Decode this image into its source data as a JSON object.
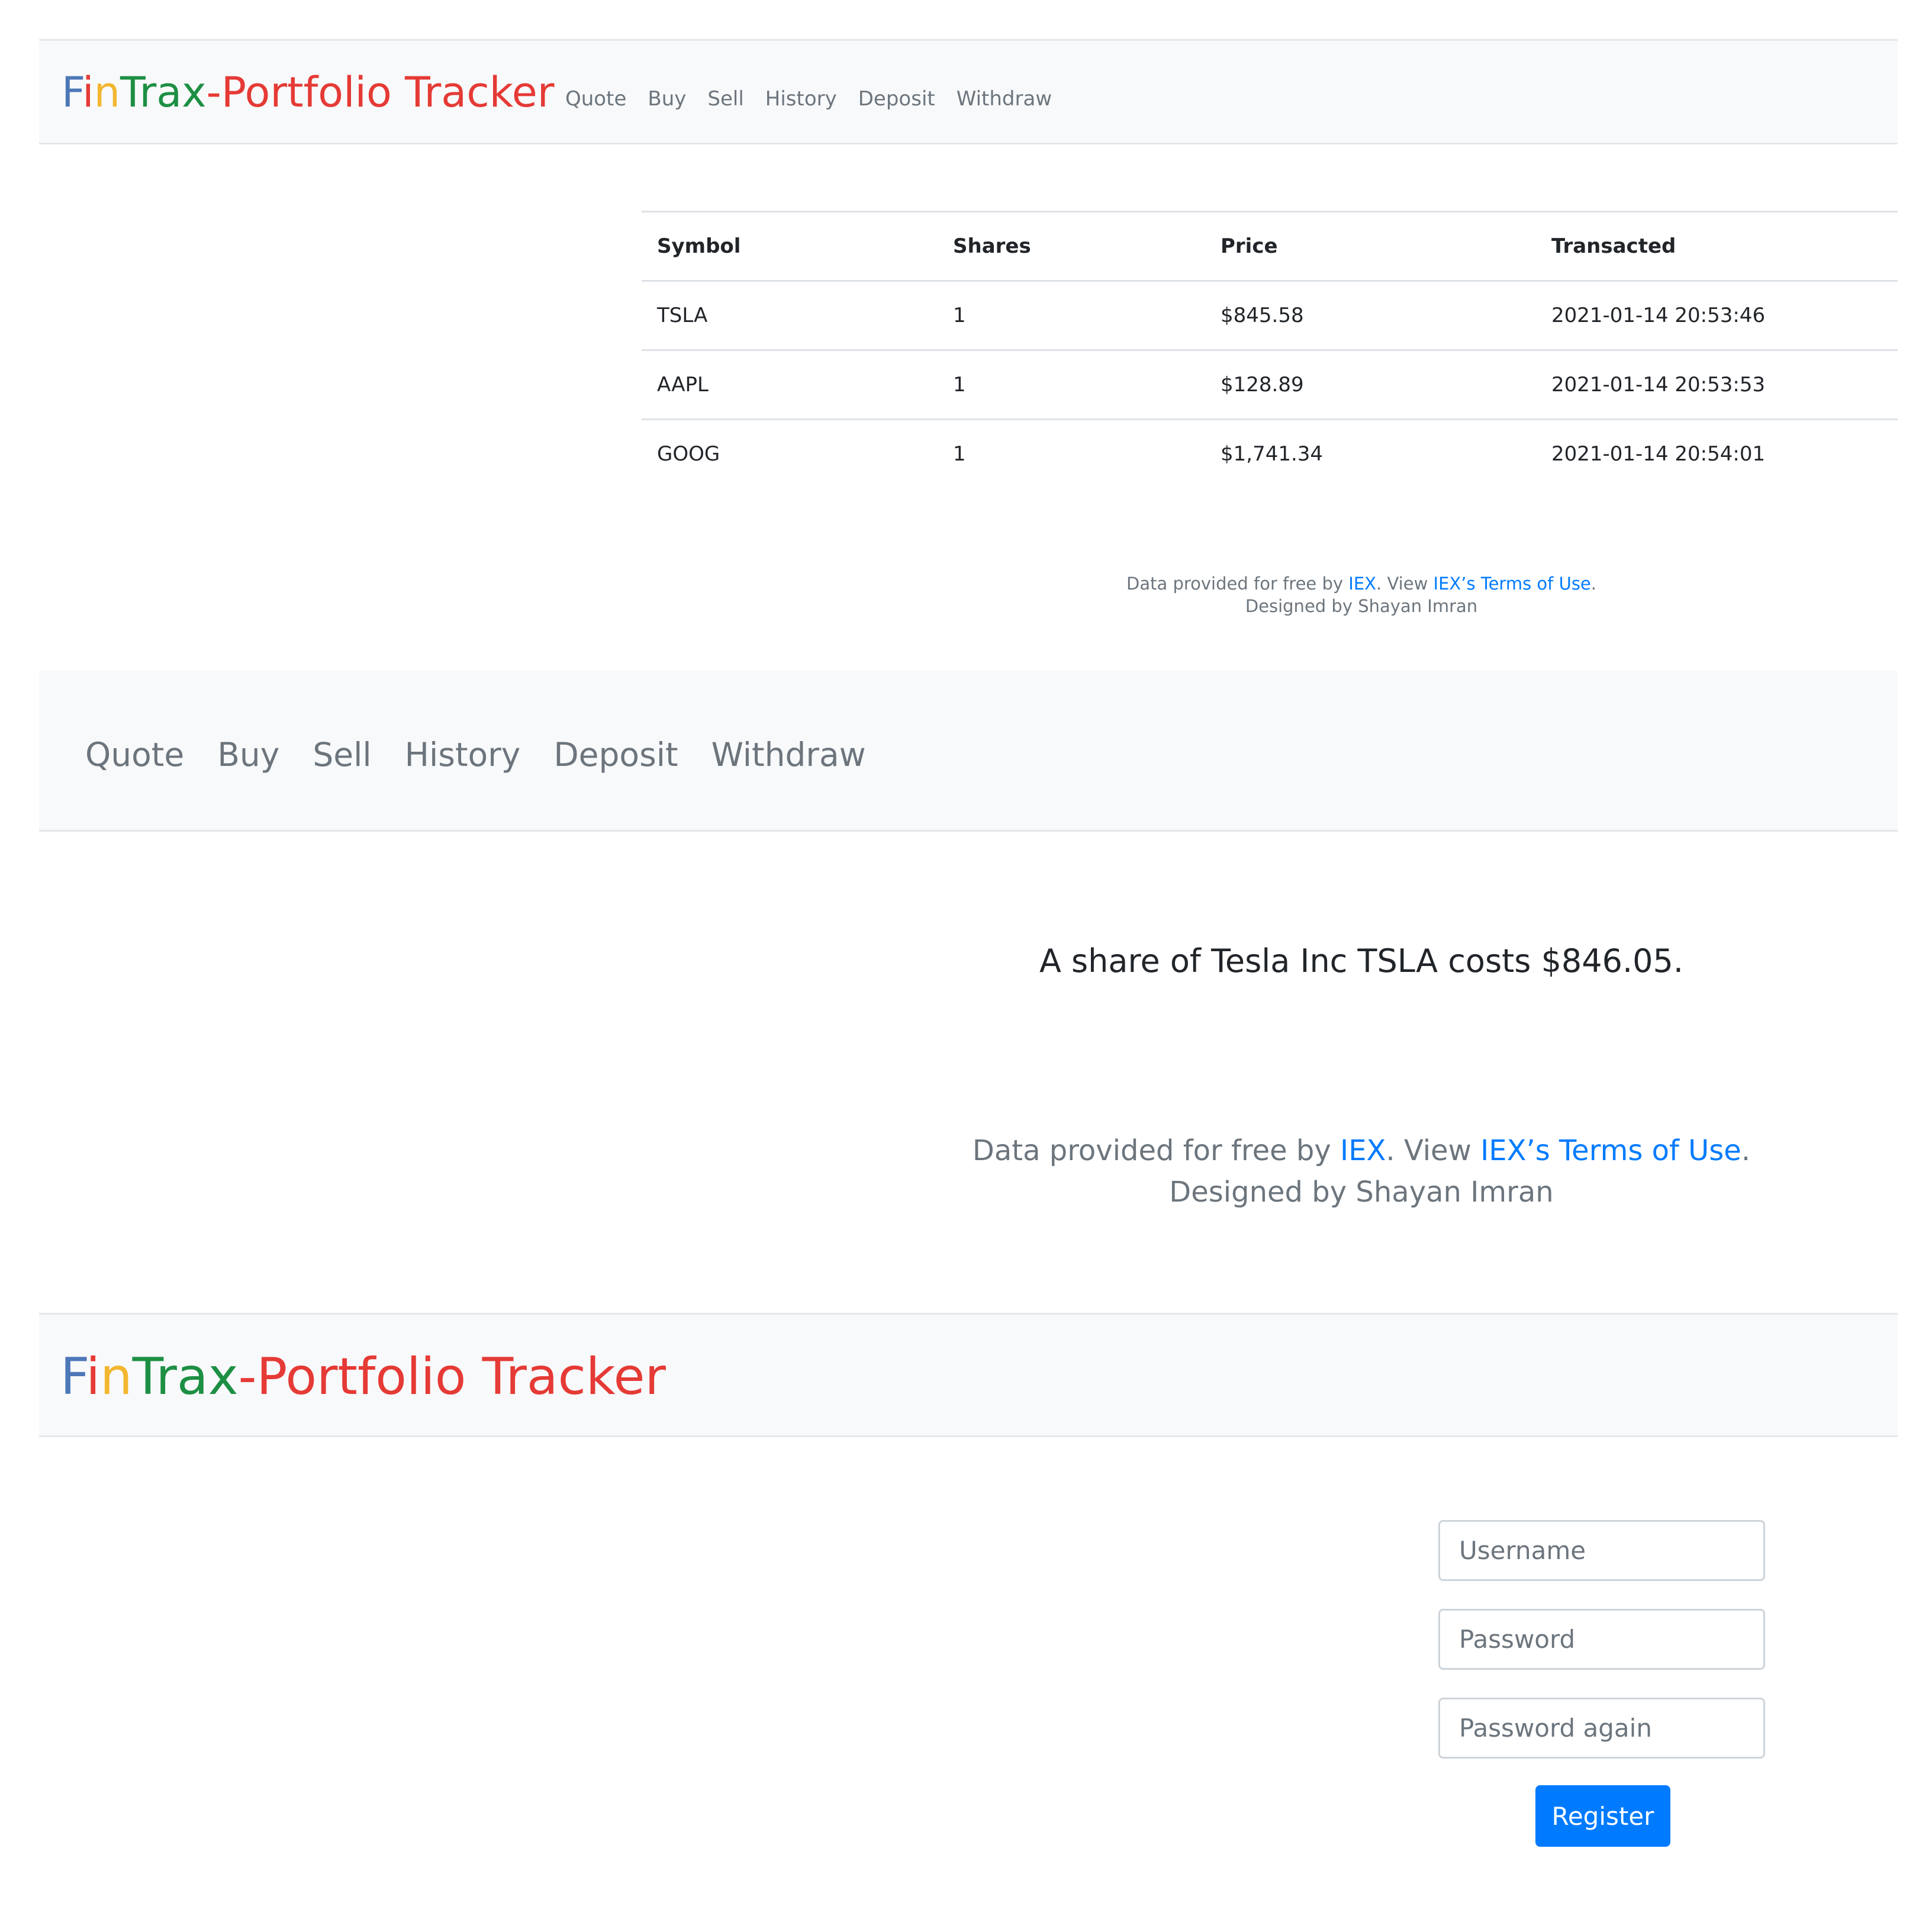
{
  "brand": {
    "f": "F",
    "i": "i",
    "n": "n",
    "trax": "Trax",
    "rest": "-Portfolio Tracker",
    "colors": {
      "f": "#4d78b8",
      "i": "#e53a35",
      "n": "#f2b62f",
      "trax": "#1d8f43",
      "rest": "#e53a35"
    }
  },
  "nav": {
    "items": [
      "Quote",
      "Buy",
      "Sell",
      "History",
      "Deposit",
      "Withdraw"
    ]
  },
  "history": {
    "headers": [
      "Symbol",
      "Shares",
      "Price",
      "Transacted"
    ],
    "rows": [
      [
        "TSLA",
        "1",
        "$845.58",
        "2021-01-14 20:53:46"
      ],
      [
        "AAPL",
        "1",
        "$128.89",
        "2021-01-14 20:53:53"
      ],
      [
        "GOOG",
        "1",
        "$1,741.34",
        "2021-01-14 20:54:01"
      ]
    ]
  },
  "footer": {
    "prefix": "Data provided for free by ",
    "iex_link": "IEX",
    "middle": ". View ",
    "terms_link": "IEX’s Terms of Use",
    "suffix": ".",
    "designed": "Designed by Shayan Imran"
  },
  "quote": {
    "message": "A share of Tesla Inc TSLA costs $846.05."
  },
  "register": {
    "username_placeholder": "Username",
    "password_placeholder": "Password",
    "password_again_placeholder": "Password again",
    "button_label": "Register",
    "button_color": "#007bff"
  }
}
